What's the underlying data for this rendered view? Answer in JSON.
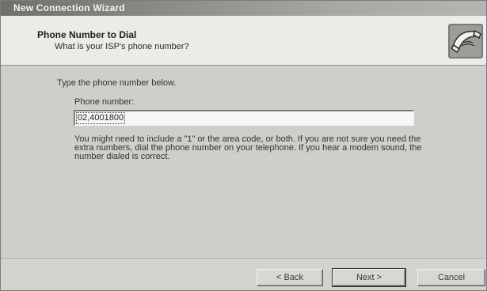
{
  "window": {
    "title": "New Connection Wizard"
  },
  "header": {
    "title": "Phone Number to Dial",
    "subtitle": "What is your ISP's phone number?",
    "icon": "phone-connection-icon"
  },
  "content": {
    "instruction": "Type the phone number below.",
    "phone_label": "Phone number:",
    "phone_value": "02,4001800",
    "hint": "You might need to include a \"1\" or the area code, or both. If you are not sure you need the extra numbers, dial the phone number on your telephone. If you hear a modem sound, the number dialed is correct."
  },
  "buttons": {
    "back": "< Back",
    "next": "Next >",
    "cancel": "Cancel"
  }
}
